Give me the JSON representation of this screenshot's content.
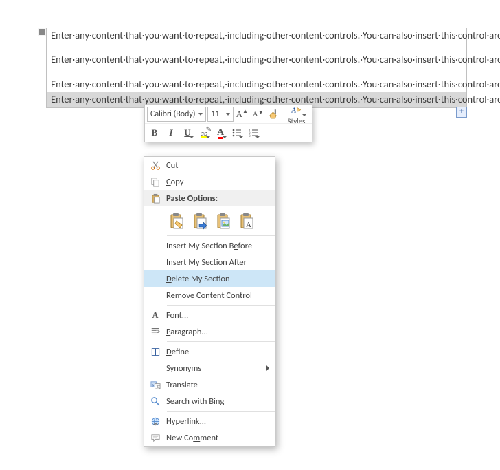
{
  "doc": {
    "para_text": "Enter·any·content·that·you·want·to·repeat,·including·other·content·controls.·You·can·also·insert·this·control·around·table·rows·in·order·to·repeat·parts·of·a·table.¶",
    "plus_label": "+"
  },
  "mini_toolbar": {
    "font_name": "Calibri (Body)",
    "font_size": "11",
    "styles_label": "Styles"
  },
  "context_menu": {
    "cut": "Cut",
    "copy": "Copy",
    "paste_header": "Paste Options:",
    "insert_before": "Insert My Section Before",
    "insert_after": "Insert My Section After",
    "delete_section": "Delete My Section",
    "remove_cc": "Remove Content Control",
    "font": "Font...",
    "paragraph": "Paragraph...",
    "define": "Define",
    "synonyms": "Synonyms",
    "translate": "Translate",
    "search_bing": "Search with Bing",
    "hyperlink": "Hyperlink...",
    "new_comment": "New Comment"
  }
}
